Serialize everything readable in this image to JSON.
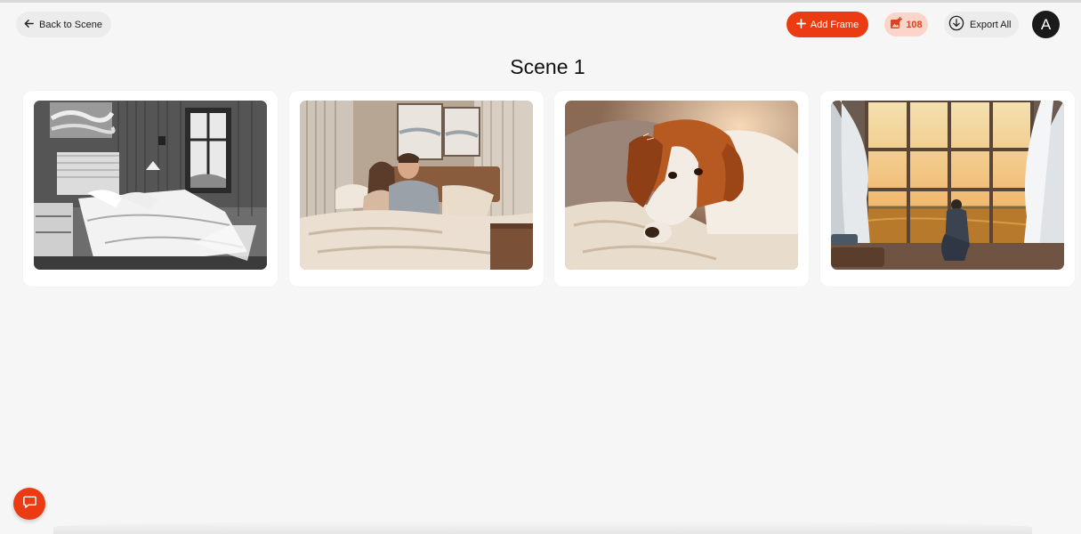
{
  "header": {
    "back_label": "Back to Scene",
    "add_frame_label": "Add Frame",
    "credits_count": "108",
    "export_label": "Export All",
    "avatar_initial": "A"
  },
  "page": {
    "title": "Scene 1"
  },
  "frames": [
    {
      "image": "bedroom-sketch-image"
    },
    {
      "image": "couple-in-bed-image"
    },
    {
      "image": "dog-resting-image"
    },
    {
      "image": "man-at-window-image"
    }
  ],
  "icons": {
    "back": "arrow-left-icon",
    "add": "plus-icon",
    "credits": "image-add-icon",
    "export": "download-circle-icon",
    "chat": "chat-bubble-icon"
  },
  "colors": {
    "accent": "#ea3b12",
    "credits_bg": "#fbd5ca",
    "page_bg": "#f6f6f6"
  }
}
